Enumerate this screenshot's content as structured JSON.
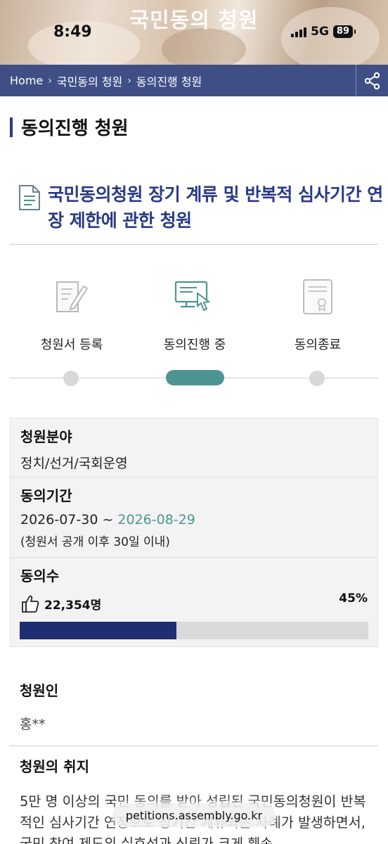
{
  "status": {
    "time": "8:49",
    "network": "5G",
    "battery": "89"
  },
  "header": {
    "title": "국민동의 청원"
  },
  "breadcrumb": [
    "Home",
    "국민동의 청원",
    "동의진행 청원"
  ],
  "section": {
    "title": "동의진행 청원"
  },
  "petition": {
    "title": "국민동의청원 장기 계류 및 반복적 심사기간 연장 제한에 관한 청원"
  },
  "steps": [
    {
      "label": "청원서 등록",
      "icon": "register-document-icon",
      "state": "inactive"
    },
    {
      "label": "동의진행 중",
      "icon": "computer-click-icon",
      "state": "active"
    },
    {
      "label": "동의종료",
      "icon": "certificate-icon",
      "state": "inactive"
    }
  ],
  "colors": {
    "navy": "#283a86",
    "breadcrumb_bg": "#3f4f86",
    "teal": "#4d9592",
    "progress_fill": "#1f2e70"
  },
  "info": {
    "field_label": "청원분야",
    "field_value": "정치/선거/국회운영",
    "period_label": "동의기간",
    "period_start": "2026-07-30",
    "period_sep": " ~ ",
    "period_end": "2026-08-29",
    "period_note": "(청원서 공개 이후 30일 이내)",
    "count_label": "동의수",
    "count_value": "22,354명",
    "percent": "45%",
    "progress": 0.45
  },
  "petitioner": {
    "label": "청원인",
    "value": "홍**"
  },
  "purpose": {
    "label": "청원의 취지",
    "body": "5만 명 이상의 국민 동의를 받아 성립된 국민동의청원이 반복적인 심사기간 연장으로 장기간 계류되는 사례가 발생하면서, 국민 참여 제도의 실효성과 신뢰가 크게 훼손"
  },
  "url": "petitions.assembly.go.kr"
}
